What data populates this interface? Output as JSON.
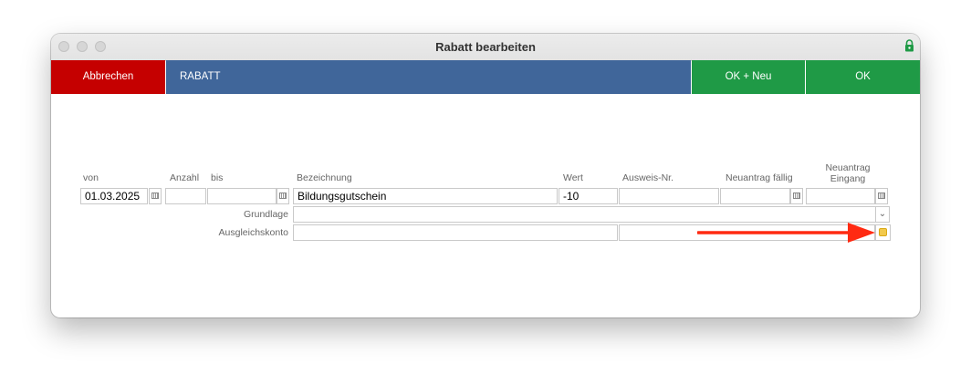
{
  "window": {
    "title": "Rabatt bearbeiten"
  },
  "actions": {
    "cancel": "Abbrechen",
    "section_title": "RABATT",
    "ok_new": "OK + Neu",
    "ok": "OK"
  },
  "form": {
    "labels": {
      "von": "von",
      "anzahl": "Anzahl",
      "bis": "bis",
      "bezeichnung": "Bezeichnung",
      "wert": "Wert",
      "ausweis": "Ausweis-Nr.",
      "neuantrag_faellig": "Neuantrag fällig",
      "neuantrag_eingang_1": "Neuantrag",
      "neuantrag_eingang_2": "Eingang",
      "grundlage": "Grundlage",
      "ausgleichskonto": "Ausgleichskonto"
    },
    "values": {
      "von": "01.03.2025",
      "anzahl": "",
      "bis": "",
      "bezeichnung": "Bildungsgutschein",
      "wert": "-10",
      "ausweis": "",
      "neuantrag_faellig": "",
      "neuantrag_eingang": "",
      "grundlage": "",
      "ausgleichskonto": "",
      "ausgleichskonto_2": ""
    }
  },
  "colors": {
    "cancel": "#c50000",
    "section": "#40669a",
    "ok": "#1f9a46",
    "arrow": "#ff2a12"
  }
}
